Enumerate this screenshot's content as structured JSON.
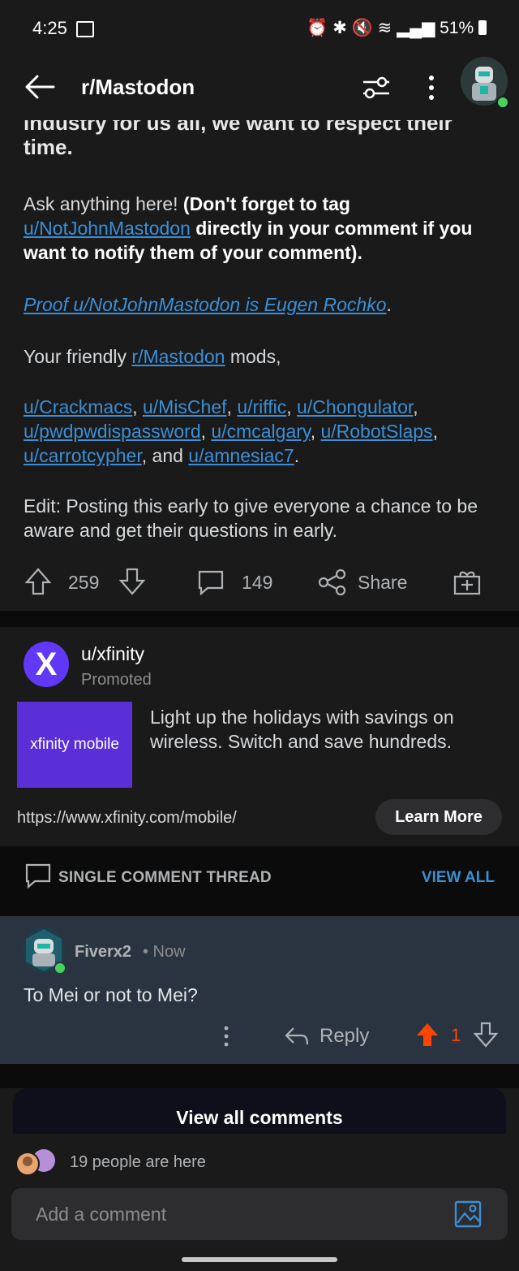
{
  "status": {
    "time": "4:25",
    "battery": "51%"
  },
  "header": {
    "title": "r/Mastodon"
  },
  "post": {
    "cut_line": "industry for us all, we want to respect their time.",
    "ask_intro": "Ask anything here! ",
    "ask_bold_1": "(Don't forget to tag ",
    "ask_link": "u/NotJohnMastodon",
    "ask_bold_2": " directly in your comment if you want to notify them of your comment).",
    "proof_link": "Proof u/NotJohnMastodon is Eugen Rochko",
    "proof_period": ".",
    "friendly_pre": "Your friendly ",
    "friendly_link": "r/Mastodon",
    "friendly_post": " mods,",
    "mods": [
      "u/Crackmacs",
      "u/MisChef",
      "u/riffic",
      "u/Chongulator",
      "u/pwdpwdispassword",
      "u/cmcalgary",
      "u/RobotSlaps",
      "u/carrotcypher"
    ],
    "mods_and": ", and ",
    "mods_last": "u/amnesiac7",
    "mods_end": ".",
    "edit": "Edit: Posting this early to give everyone a chance to be aware and get their questions in early.",
    "upvotes": "259",
    "comments": "149",
    "share": "Share"
  },
  "ad": {
    "logo_letter": "X",
    "user": "u/xfinity",
    "promoted": "Promoted",
    "banner": "xfinity mobile",
    "copy": "Light up the holidays with savings on wireless. Switch and save hundreds.",
    "url": "https://www.xfinity.com/mobile/",
    "cta": "Learn More"
  },
  "thread": {
    "label": "SINGLE COMMENT THREAD",
    "view_all": "VIEW ALL"
  },
  "comment": {
    "author": "Fiverx2",
    "time": "• Now",
    "body": "To Mei or not to Mei?",
    "reply": "Reply",
    "score": "1"
  },
  "footer": {
    "view_all_comments": "View all comments",
    "people_here": "19 people are here",
    "input_placeholder": "Add a comment"
  },
  "colors": {
    "link": "#3b8fd6",
    "upvoted": "#ff4500",
    "online": "#46d160",
    "xfinity": "#6138f5"
  }
}
